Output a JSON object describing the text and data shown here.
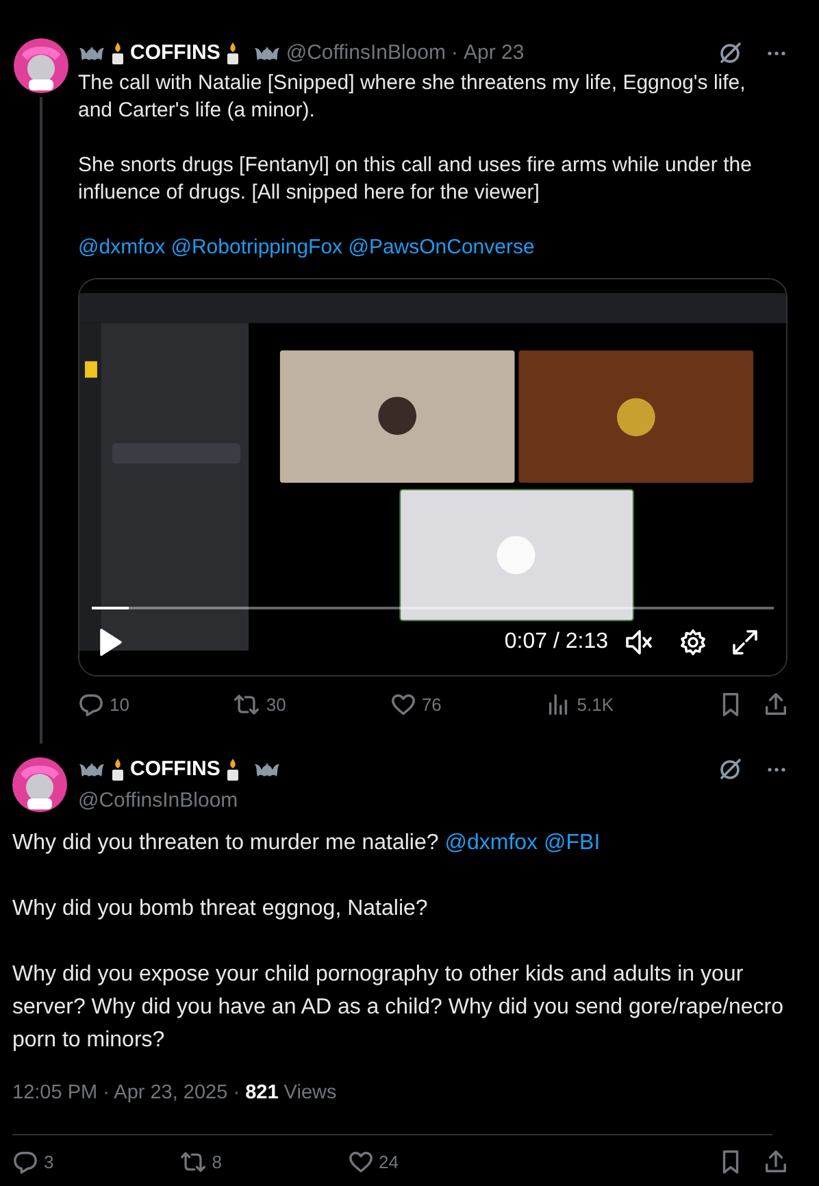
{
  "tweets": [
    {
      "author": {
        "name": "COFFINS",
        "handle": "@CoffinsInBloom"
      },
      "separator": "·",
      "date": "Apr 23",
      "kind": "thread",
      "paragraphs": [
        {
          "text": "The call with Natalie [Snipped] where she threatens my life, Eggnog's life, and Carter's life (a minor)."
        },
        {
          "text": "She snorts drugs [Fentanyl] on this call and uses fire arms while under the influence of drugs. [All snipped here for the viewer]"
        },
        {
          "mentions": [
            "@dxmfox",
            "@RobotrippingFox",
            "@PawsOnConverse"
          ]
        }
      ],
      "video": {
        "kind": "picture",
        "time": "0:07 / 2:13",
        "progress": {
          "level": 0.055
        },
        "muted": true
      },
      "actions": {
        "replies": "10",
        "reposts": "30",
        "likes": "76",
        "views": "5.1K"
      }
    },
    {
      "author": {
        "name": "COFFINS",
        "handle": "@CoffinsInBloom"
      },
      "kind": "main",
      "paragraphs": [
        {
          "text": "Why did you threaten to murder me natalie?",
          "mentions": [
            "@dxmfox",
            "@FBI"
          ]
        },
        {
          "text": "Why did you bomb threat eggnog, Natalie?"
        },
        {
          "text": "Why did you expose your child pornography to other kids and adults in your server? Why did you have an AD as a child? Why did you send gore/rape/necro porn to minors?"
        }
      ],
      "timestamp": "12:05 PM · Apr 23, 2025 · **821** Views",
      "actions": {
        "replies": "3",
        "reposts": "8",
        "likes": "24"
      }
    }
  ]
}
